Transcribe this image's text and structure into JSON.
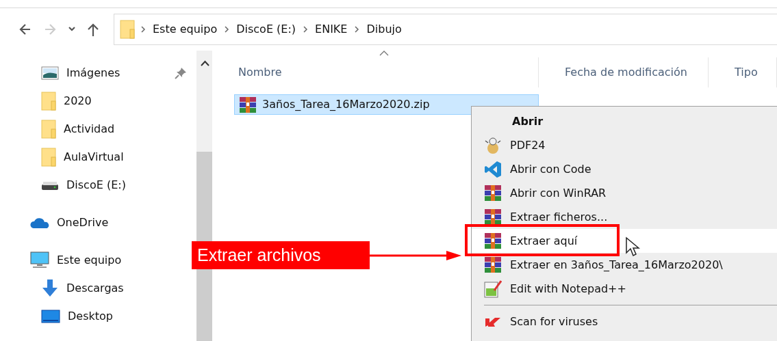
{
  "nav_buttons": [
    {
      "kind": "back",
      "disabled": false
    },
    {
      "kind": "forward",
      "disabled": true
    },
    {
      "kind": "recent",
      "disabled": false
    },
    {
      "kind": "up",
      "disabled": false
    }
  ],
  "breadcrumb": [
    "Este equipo",
    "DiscoE (E:)",
    "ENIKE",
    "Dibujo"
  ],
  "sidebar": {
    "pinned_items": [
      {
        "label": "Imágenes",
        "pinned": true
      },
      {
        "label": "2020",
        "pinned": false
      },
      {
        "label": "Actividad",
        "pinned": false
      },
      {
        "label": "AulaVirtual",
        "pinned": false
      },
      {
        "label": "DiscoE (E:)",
        "pinned": false
      }
    ],
    "items": [
      {
        "label": "OneDrive"
      },
      {
        "label": "Este equipo",
        "children": [
          {
            "label": "Descargas"
          },
          {
            "label": "Desktop"
          }
        ]
      }
    ]
  },
  "table": {
    "columns": [
      "Nombre",
      "Fecha de modificación",
      "Tipo"
    ],
    "rows": [
      {
        "name": "3años_Tarea_16Marzo2020.zip",
        "selected": true
      }
    ]
  },
  "context_menu": [
    {
      "kind": "default",
      "label": "Abrir",
      "selected": false
    },
    {
      "kind": "item",
      "label": "PDF24",
      "selected": false
    },
    {
      "kind": "item",
      "label": "Abrir con Code",
      "selected": false
    },
    {
      "kind": "item",
      "label": "Abrir con WinRAR",
      "selected": false
    },
    {
      "kind": "item",
      "label": "Extraer ficheros...",
      "selected": false
    },
    {
      "kind": "item",
      "label": "Extraer aquí",
      "selected": true
    },
    {
      "kind": "item",
      "label": "Extraer en 3años_Tarea_16Marzo2020\\",
      "selected": false
    },
    {
      "kind": "item",
      "label": "Edit with Notepad++",
      "selected": false
    },
    {
      "kind": "separator"
    },
    {
      "kind": "item",
      "label": "Scan for viruses",
      "selected": false
    }
  ],
  "annotation": {
    "label": "Extraer archivos"
  }
}
